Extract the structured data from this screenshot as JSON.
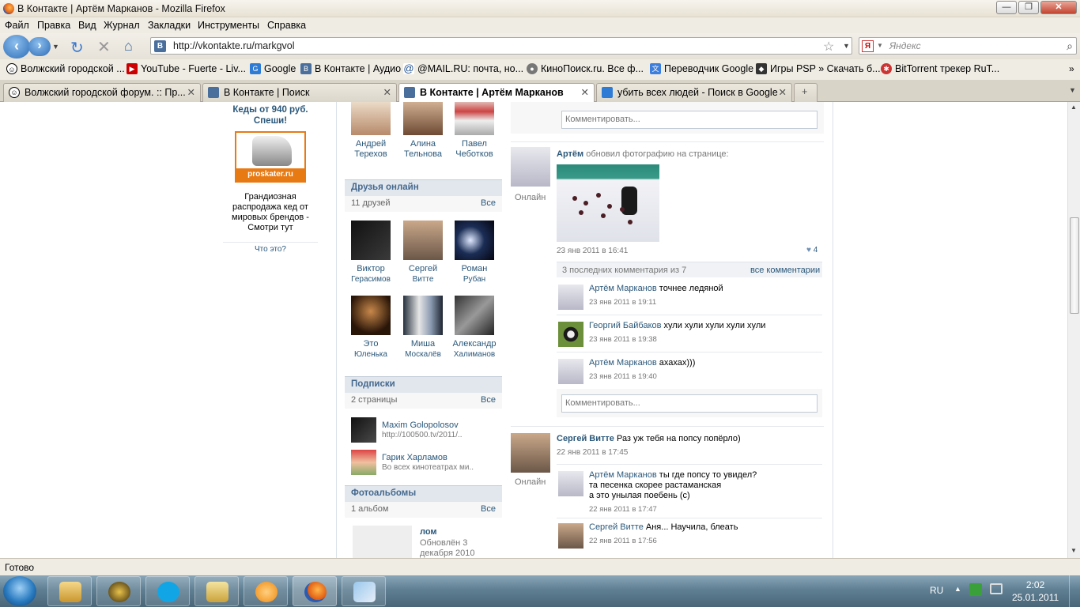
{
  "window": {
    "title": "В Контакте | Артём Марканов - Mozilla Firefox"
  },
  "menu": [
    "Файл",
    "Правка",
    "Вид",
    "Журнал",
    "Закладки",
    "Инструменты",
    "Справка"
  ],
  "nav": {
    "url": "http://vkontakte.ru/markgvol",
    "search_placeholder": "Яндекс",
    "vk_icon": "B",
    "ya_icon": "Я"
  },
  "bookmarks": [
    "Волжский городской ...",
    "YouTube - Fuerte - Liv...",
    "Google",
    "В Контакте | Аудио",
    "@MAIL.RU: почта, но...",
    "КиноПоиск.ru. Все ф...",
    "Переводчик Google",
    "Игры PSP » Скачать б...",
    "BitTorrent трекер RuT..."
  ],
  "tabs": [
    {
      "label": "Волжский городской форум. :: Пр...",
      "close": "✕"
    },
    {
      "label": "В Контакте | Поиск",
      "close": "✕"
    },
    {
      "label": "В Контакте | Артём Марканов",
      "close": "✕"
    },
    {
      "label": "убить всех людей - Поиск в Google",
      "close": "✕"
    }
  ],
  "ad": {
    "title": "Кеды от 940 руб. Спеши!",
    "brand": "proskater.ru",
    "text": "Грандиозная распродажа кед от мировых брендов - Смотри тут",
    "what": "Что это?"
  },
  "friends_top": [
    {
      "first": "Андрей",
      "last": "Терехов"
    },
    {
      "first": "Алина",
      "last": "Тельнова"
    },
    {
      "first": "Павел",
      "last": "Чеботков"
    }
  ],
  "online": {
    "title": "Друзья онлайн",
    "count": "11 друзей",
    "all": "Все"
  },
  "friends_online": [
    {
      "first": "Виктор",
      "last": "Герасимов"
    },
    {
      "first": "Сергей",
      "last": "Витте"
    },
    {
      "first": "Роман",
      "last": "Рубан"
    },
    {
      "first": "Это",
      "last": "Юленька"
    },
    {
      "first": "Миша",
      "last": "Москалёв"
    },
    {
      "first": "Александр",
      "last": "Халиманов"
    }
  ],
  "subs": {
    "title": "Подписки",
    "count": "2 страницы",
    "all": "Все",
    "items": [
      {
        "name": "Maxim Golopolosov",
        "desc": "http://100500.tv/2011/.."
      },
      {
        "name": "Гарик Харламов",
        "desc": "Во всех кинотеатрах ми.."
      }
    ]
  },
  "albums": {
    "title": "Фотоальбомы",
    "count": "1 альбом",
    "all": "Все",
    "name": "лом",
    "updated": "Обновлён 3 декабря 2010"
  },
  "wall": {
    "comment_placeholder": "Комментировать...",
    "post1": {
      "author": "Артём",
      "action": "обновил фотографию на странице:",
      "online": "Онлайн",
      "date": "23 янв 2011 в 16:41",
      "likes": "4",
      "comments_header": "3 последних комментария из 7",
      "all_comments": "все комментарии",
      "comments": [
        {
          "author": "Артём Марканов",
          "text": "точнее ледяной",
          "date": "23 янв 2011 в 19:11"
        },
        {
          "author": "Георгий Байбаков",
          "text": "хули хули хули хули хули",
          "date": "23 янв 2011 в 19:38"
        },
        {
          "author": "Артём Марканов",
          "text": "ахахах)))",
          "date": "23 янв 2011 в 19:40"
        }
      ]
    },
    "post2": {
      "author": "Сергей Витте",
      "text": "Раз уж тебя на попсу попёрло)",
      "date": "22 янв 2011 в 17:45",
      "online": "Онлайн",
      "comments": [
        {
          "author": "Артём Марканов",
          "text1": "ты где попсу то увидел?",
          "text2": "та песенка скорее растаманская",
          "text3": "а это унылая поебень (c)",
          "date": "22 янв 2011 в 17:47"
        },
        {
          "author": "Сергей Витте",
          "text": "Аня... Научила, блеать",
          "date": "22 янв 2011 в 17:56"
        }
      ]
    }
  },
  "status": "Готово",
  "tray": {
    "lang": "RU",
    "time": "2:02",
    "date": "25.01.2011"
  }
}
